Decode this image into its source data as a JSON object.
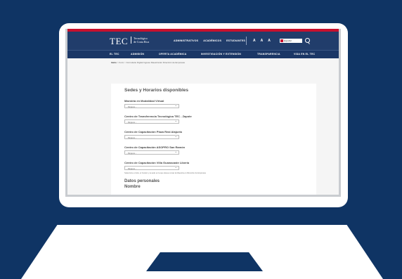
{
  "header": {
    "logo_text": "TEC",
    "logo_sub_1": "Tecnológico",
    "logo_sub_2": "de Costa Rica",
    "top_links": [
      "ADMINISTRATIVOS",
      "ACADÉMICOS",
      "ESTUDIANTES"
    ],
    "font_sizes": [
      "A",
      "A",
      "A"
    ],
    "language": "Español"
  },
  "nav": {
    "items": [
      "EL TEC",
      "ADMISIÓN",
      "OFERTA ACADÉMICA",
      "INVESTIGACIÓN Y EXTENSIÓN",
      "TRANSPARENCIA",
      "VIDA EN EL TEC"
    ]
  },
  "breadcrumb": {
    "home": "Inicio",
    "sep": ">",
    "forms": "Form",
    "current": "Formulario Digital Ingreso Maestría En Dirección de Empresas"
  },
  "form": {
    "section_title": "Sedes y Horarios disponibles",
    "fields": [
      {
        "label": "Maestría en Modalidad Virtual",
        "value": "- Ninguno -"
      },
      {
        "label": "Centro de Transferencia Tecnológica TEC - Zapote",
        "value": "- Ninguno -"
      },
      {
        "label": "Centro de Capacitación Plaza Real Alajuela",
        "value": "- Ninguno -"
      },
      {
        "label": "Centro de Capacitación ASOPRO San Ramón",
        "value": "- Ninguno -"
      },
      {
        "label": "Centro de Capacitación Villa Guanacaste Liberia",
        "value": "- Ninguno -"
      }
    ],
    "help": "Seleccione el sitio, el horario y la sede en la que desea cursar la Maestría en Dirección de Empresas",
    "personal_title": "Datos personales",
    "name_label": "Nombre"
  },
  "colors": {
    "background": "#0f3464",
    "header": "#213d6b",
    "accent": "#c8102e"
  }
}
